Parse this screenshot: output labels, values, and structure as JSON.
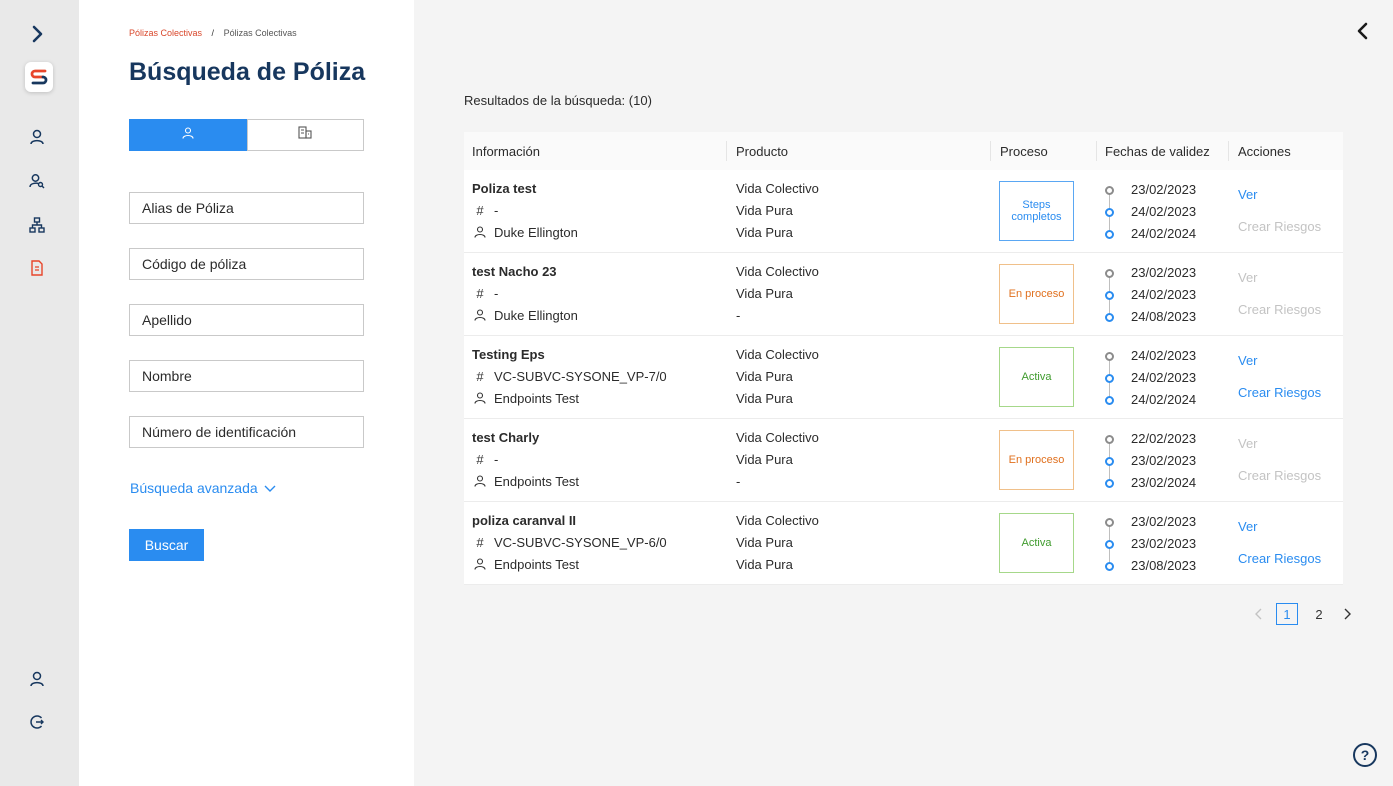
{
  "colors": {
    "accent": "#2a8cf0",
    "brand_dark": "#17375e",
    "brand_red": "#d9472b"
  },
  "rail": {
    "items": [
      {
        "icon": "chevron-right-icon"
      },
      {
        "icon": "app-logo-icon"
      },
      {
        "icon": "user-icon"
      },
      {
        "icon": "users-search-icon"
      },
      {
        "icon": "hierarchy-icon"
      },
      {
        "icon": "document-icon"
      },
      {
        "icon": "profile-icon"
      },
      {
        "icon": "logout-icon"
      }
    ]
  },
  "breadcrumb": {
    "item1": "Pólizas Colectivas",
    "separator": "/",
    "item2": "Pólizas Colectivas"
  },
  "page_title": "Búsqueda de Póliza",
  "search_type": {
    "options": [
      {
        "icon": "person-icon",
        "selected": true
      },
      {
        "icon": "building-icon",
        "selected": false
      }
    ]
  },
  "form": {
    "alias_placeholder": "Alias de Póliza",
    "codigo_placeholder": "Código de póliza",
    "apellido_placeholder": "Apellido",
    "nombre_placeholder": "Nombre",
    "numero_placeholder": "Número de identificación",
    "advanced_label": "Búsqueda avanzada",
    "search_button": "Buscar"
  },
  "results": {
    "count_label": "Resultados de la búsqueda: (10)",
    "headers": {
      "info": "Información",
      "producto": "Producto",
      "proceso": "Proceso",
      "fechas": "Fechas de validez",
      "acciones": "Acciones"
    },
    "rows": [
      {
        "title": "Poliza test",
        "code": "-",
        "person": "Duke Ellington",
        "prod1": "Vida Colectivo",
        "prod2": "Vida Pura",
        "prod3": "Vida Pura",
        "status": "Steps completos",
        "status_color": "blue",
        "d1": "23/02/2023",
        "d2": "24/02/2023",
        "d3": "24/02/2024",
        "ver": "Ver",
        "ver_enabled": true,
        "crear": "Crear Riesgos",
        "crear_enabled": false
      },
      {
        "title": "test Nacho 23",
        "code": "-",
        "person": "Duke Ellington",
        "prod1": "Vida Colectivo",
        "prod2": "Vida Pura",
        "prod3": "-",
        "status": "En proceso",
        "status_color": "orange",
        "d1": "23/02/2023",
        "d2": "24/02/2023",
        "d3": "24/08/2023",
        "ver": "Ver",
        "ver_enabled": false,
        "crear": "Crear Riesgos",
        "crear_enabled": false
      },
      {
        "title": "Testing Eps",
        "code": "VC-SUBVC-SYSONE_VP-7/0",
        "person": "Endpoints Test",
        "prod1": "Vida Colectivo",
        "prod2": "Vida Pura",
        "prod3": "Vida Pura",
        "status": "Activa",
        "status_color": "green",
        "d1": "24/02/2023",
        "d2": "24/02/2023",
        "d3": "24/02/2024",
        "ver": "Ver",
        "ver_enabled": true,
        "crear": "Crear Riesgos",
        "crear_enabled": true
      },
      {
        "title": "test Charly",
        "code": "-",
        "person": "Endpoints Test",
        "prod1": "Vida Colectivo",
        "prod2": "Vida Pura",
        "prod3": "-",
        "status": "En proceso",
        "status_color": "orange",
        "d1": "22/02/2023",
        "d2": "23/02/2023",
        "d3": "23/02/2024",
        "ver": "Ver",
        "ver_enabled": false,
        "crear": "Crear Riesgos",
        "crear_enabled": false
      },
      {
        "title": "poliza caranval II",
        "code": "VC-SUBVC-SYSONE_VP-6/0",
        "person": "Endpoints Test",
        "prod1": "Vida Colectivo",
        "prod2": "Vida Pura",
        "prod3": "Vida Pura",
        "status": "Activa",
        "status_color": "green",
        "d1": "23/02/2023",
        "d2": "23/02/2023",
        "d3": "23/08/2023",
        "ver": "Ver",
        "ver_enabled": true,
        "crear": "Crear Riesgos",
        "crear_enabled": true
      }
    ]
  },
  "pagination": {
    "pages": [
      "1",
      "2"
    ],
    "current": "1"
  },
  "help_label": "?"
}
